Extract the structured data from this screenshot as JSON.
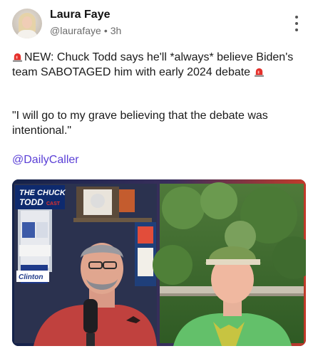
{
  "author": {
    "name": "Laura Faye",
    "handle": "@laurafaye",
    "time": "3h"
  },
  "post": {
    "line1_text": "NEW: Chuck Todd says he'll *always* believe Biden's team SABOTAGED him with early 2024 debate",
    "quote": "\"I will go to my grave believing that the debate was intentional.\"",
    "mention": "@DailyCaller"
  },
  "media": {
    "show_logo_line1": "THE CHUCK",
    "show_logo_line2": "TODD",
    "show_logo_line3": "CAST",
    "sign_text": "Clinton"
  },
  "icons": {
    "siren": "siren-icon",
    "more": "more-vertical-icon"
  },
  "colors": {
    "mention": "#5a3fd6",
    "siren": "#e5302b"
  }
}
